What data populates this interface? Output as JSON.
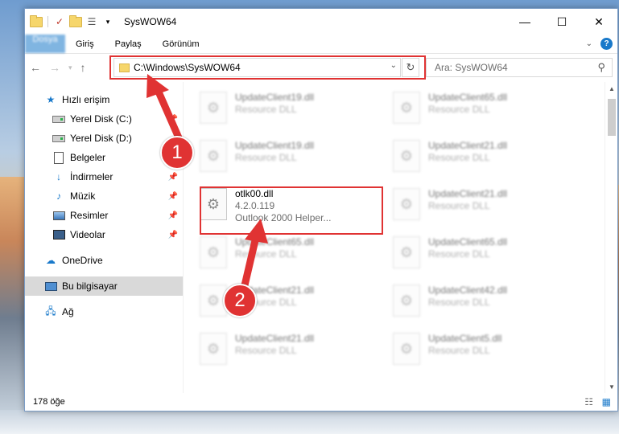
{
  "window": {
    "title": "SysWOW64",
    "controls": {
      "minimize": "—",
      "maximize": "☐",
      "close": "✕"
    }
  },
  "ribbon": {
    "tabs": [
      "Dosya",
      "Giriş",
      "Paylaş",
      "Görünüm"
    ],
    "help": "?",
    "expand": "⌄"
  },
  "address": {
    "path": "C:\\Windows\\SysWOW64",
    "search_placeholder": "Ara: SysWOW64"
  },
  "sidebar": {
    "quick_access": "Hızlı erişim",
    "items": [
      {
        "label": "Yerel Disk (C:)",
        "pinned": true
      },
      {
        "label": "Yerel Disk (D:)",
        "pinned": false
      },
      {
        "label": "Belgeler",
        "pinned": true
      },
      {
        "label": "İndirmeler",
        "pinned": true
      },
      {
        "label": "Müzik",
        "pinned": true
      },
      {
        "label": "Resimler",
        "pinned": true
      },
      {
        "label": "Videolar",
        "pinned": true
      }
    ],
    "onedrive": "OneDrive",
    "this_pc": "Bu bilgisayar",
    "network": "Ağ"
  },
  "files": [
    {
      "name": "UpdateClient19.dll",
      "type": "Resource DLL"
    },
    {
      "name": "UpdateClient65.dll",
      "type": "Resource DLL"
    },
    {
      "name": "UpdateClient19.dll",
      "type": "Resource DLL"
    },
    {
      "name": "UpdateClient21.dll",
      "type": "Resource DLL"
    },
    {
      "name": "otlk00.dll",
      "version": "4.2.0.119",
      "type": "Outlook 2000 Helper..."
    },
    {
      "name": "UpdateClient21.dll",
      "type": "Resource DLL"
    },
    {
      "name": "UpdateClient65.dll",
      "type": "Resource DLL"
    },
    {
      "name": "UpdateClient65.dll",
      "type": "Resource DLL"
    },
    {
      "name": "UpdateClient21.dll",
      "type": "Resource DLL"
    },
    {
      "name": "UpdateClient42.dll",
      "type": "Resource DLL"
    },
    {
      "name": "UpdateClient21.dll",
      "type": "Resource DLL"
    },
    {
      "name": "UpdateClient5.dll",
      "type": "Resource DLL"
    }
  ],
  "status": {
    "count": "178 öğe"
  },
  "annotations": {
    "badge1": "1",
    "badge2": "2",
    "color": "#e03333"
  }
}
